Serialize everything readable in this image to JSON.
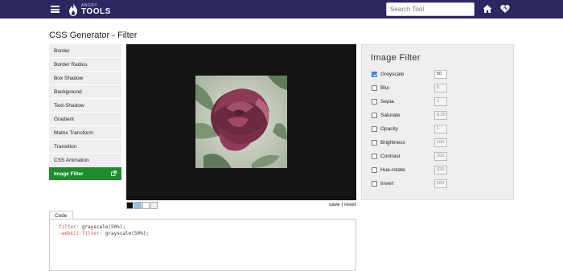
{
  "header": {
    "logo_top": "ANGRY",
    "logo_main": "TOOLS",
    "search_placeholder": "Search Tool",
    "icons": [
      "menu-icon",
      "home-icon",
      "heart-icon"
    ],
    "bar_color": "#2a2761"
  },
  "page": {
    "title": "CSS Generator - Filter"
  },
  "sidebar": {
    "items": [
      {
        "label": "Border"
      },
      {
        "label": "Border Radius"
      },
      {
        "label": "Box Shadow"
      },
      {
        "label": "Background"
      },
      {
        "label": "Text-Shadow"
      },
      {
        "label": "Gradient"
      },
      {
        "label": "Matrix Transform"
      },
      {
        "label": "Transition"
      },
      {
        "label": "CSS Animation"
      },
      {
        "label": "Image Filter",
        "active": true
      }
    ],
    "active_color": "#1e8b2d"
  },
  "preview": {
    "background": "#141414",
    "image": "rose-flower-image",
    "swatch_colors": [
      "#111111",
      "#87c5e8",
      "#ffffff",
      "#eeeeee"
    ],
    "save_label": "save",
    "separator": "|",
    "reset_label": "reset"
  },
  "filter_panel": {
    "title": "Image Filter",
    "filters": [
      {
        "label": "Greyscale",
        "checked": true,
        "value": "50"
      },
      {
        "label": "Blur",
        "checked": false,
        "value": "5"
      },
      {
        "label": "Sepia",
        "checked": false,
        "value": "1"
      },
      {
        "label": "Saturate",
        "checked": false,
        "value": "0.25"
      },
      {
        "label": "Opacity",
        "checked": false,
        "value": "1"
      },
      {
        "label": "Brightness",
        "checked": false,
        "value": "100"
      },
      {
        "label": "Contrast",
        "checked": false,
        "value": "100"
      },
      {
        "label": "Hue-rotate",
        "checked": false,
        "value": "320"
      },
      {
        "label": "Invert",
        "checked": false,
        "value": "100"
      }
    ]
  },
  "code": {
    "tab_label": "Code",
    "lines": [
      {
        "prop": "filter:",
        "val": " grayscale(50%);"
      },
      {
        "prop": "-webkit-filter:",
        "val": " grayscale(50%);"
      }
    ]
  }
}
